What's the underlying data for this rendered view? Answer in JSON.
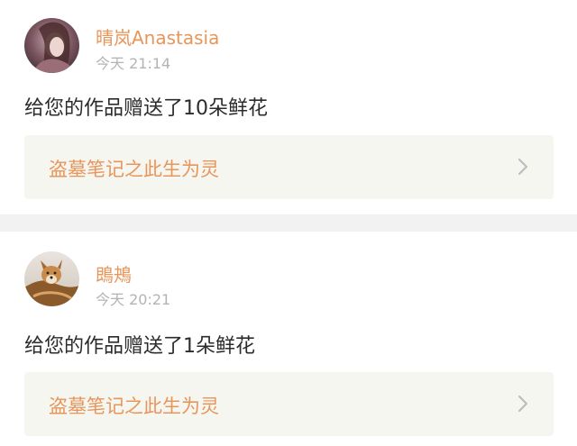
{
  "notifications": [
    {
      "username": "晴岚Anastasia",
      "timestamp": "今天 21:14",
      "message": "给您的作品赠送了10朵鲜花",
      "work_title": "盗墓笔记之此生为灵",
      "avatar_icon": "avatar-woman-portrait"
    },
    {
      "username": "鵖鴂",
      "timestamp": "今天 20:21",
      "message": "给您的作品赠送了1朵鲜花",
      "work_title": "盗墓笔记之此生为灵",
      "avatar_icon": "avatar-dog-photo"
    }
  ],
  "colors": {
    "accent": "#e8955a",
    "timestamp": "#b3b3b3",
    "message": "#2b2b2b",
    "link_background": "#f6f6f1",
    "divider": "#f2f2f2"
  }
}
